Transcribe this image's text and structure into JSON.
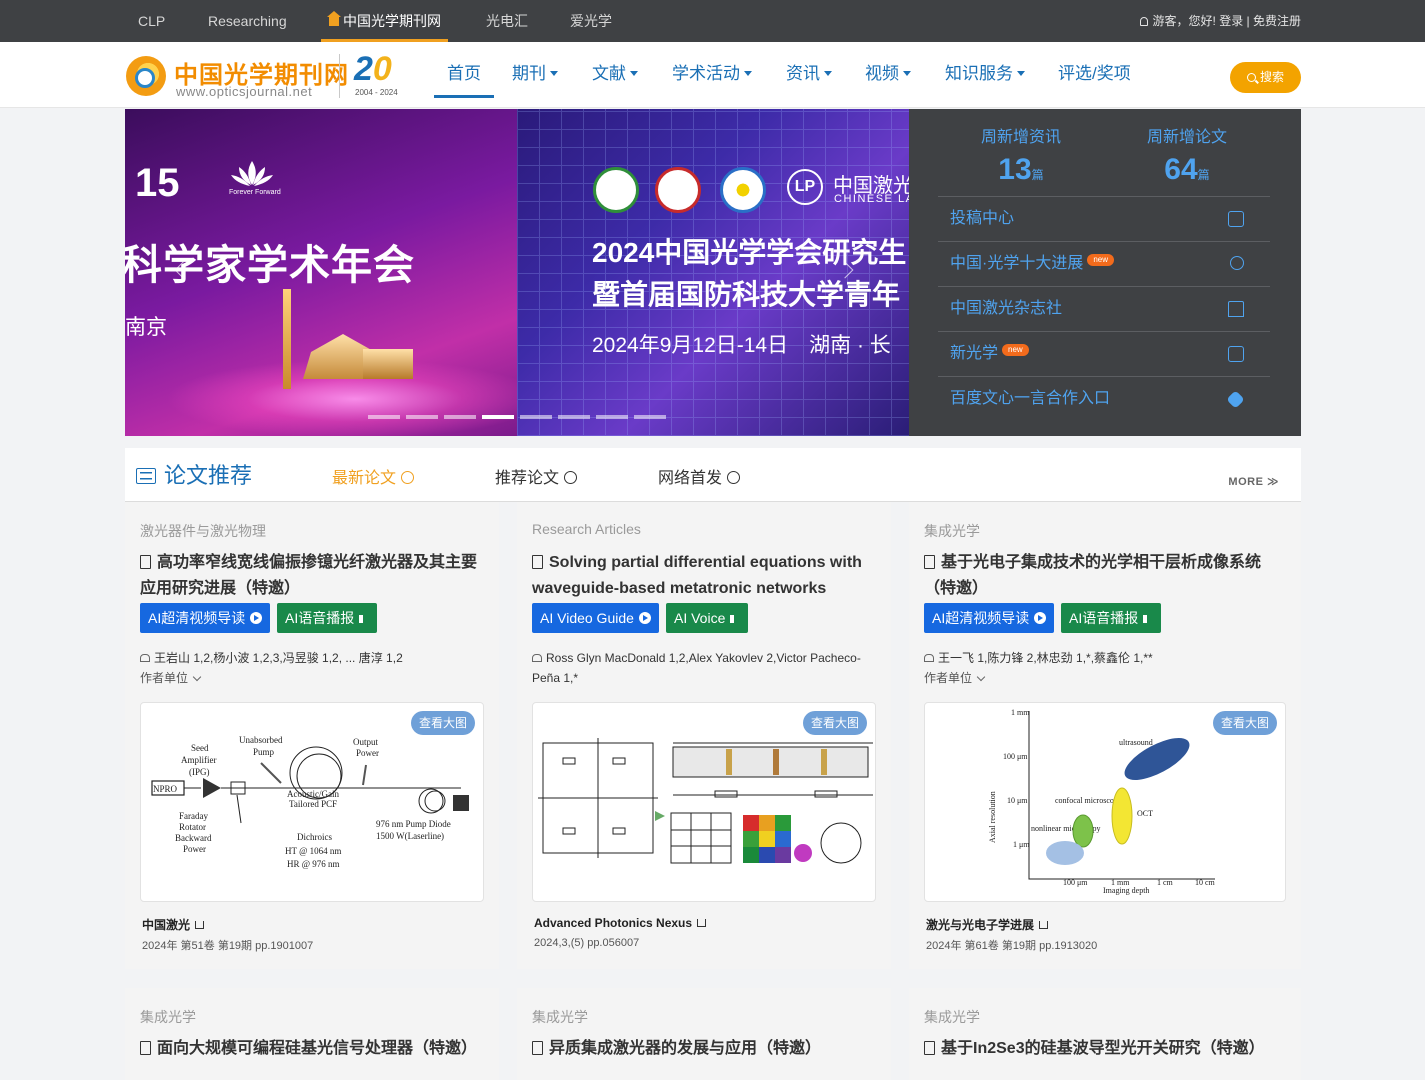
{
  "topbar": {
    "links": [
      "CLP",
      "Researching",
      "中国光学期刊网",
      "光电汇",
      "爱光学"
    ],
    "user_text": "游客，您好! 登录 | 免费注册"
  },
  "header": {
    "logo_cn": "中国光学期刊网",
    "logo_en": "www.opticsjournal.net",
    "logo_years": "2004 - 2024",
    "nav": [
      "首页",
      "期刊",
      "文献",
      "学术活动",
      "资讯",
      "视频",
      "知识服务",
      "评选/奖项"
    ],
    "search_label": "搜索"
  },
  "banner": {
    "slide1": {
      "logo_num": "15",
      "logo_sub": "Forever Forward",
      "title": "科学家学术年会",
      "place": "南京"
    },
    "slide2": {
      "lp_cn": "中国激光",
      "lp_en": "CHINESE LA",
      "line1": "2024中国光学学会研究生",
      "line2": "暨首届国防科技大学青年",
      "line3": "2024年9月12日-14日　湖南 · 长"
    }
  },
  "side": {
    "stat1_label": "周新增资讯",
    "stat1_value": "13",
    "stat1_unit": "篇",
    "stat2_label": "周新增论文",
    "stat2_value": "64",
    "stat2_unit": "篇",
    "links": [
      "投稿中心",
      "中国·光学十大进展",
      "中国激光杂志社",
      "新光学",
      "百度文心一言合作入口"
    ],
    "new_badge": "new"
  },
  "section": {
    "title": "论文推荐",
    "tabs": [
      "最新论文",
      "推荐论文",
      "网络首发"
    ],
    "more": "MORE"
  },
  "cards": [
    {
      "category": "激光器件与激光物理",
      "title": "高功率窄线宽线偏振掺镱光纤激光器及其主要应用研究进展（特邀）",
      "btn1": "AI超清视频导读",
      "btn2": "AI语音播报",
      "authors": "王岩山 1,2,杨小波 1,2,3,冯昱骏 1,2, ... 唐淳 1,2",
      "unit": "作者单位",
      "view": "查看大图",
      "journal": "中国激光",
      "volume": "2024年 第51卷 第19期 pp.1901007"
    },
    {
      "category": "Research Articles",
      "title": "Solving partial differential equations with waveguide-based metatronic networks",
      "btn1": "AI Video Guide",
      "btn2": "AI Voice",
      "authors": "Ross Glyn MacDonald 1,2,Alex Yakovlev 2,Victor Pacheco-Peña 1,*",
      "unit": "",
      "view": "查看大图",
      "journal": "Advanced Photonics Nexus",
      "volume": "2024,3,(5) pp.056007"
    },
    {
      "category": "集成光学",
      "title": "基于光电子集成技术的光学相干层析成像系统（特邀）",
      "btn1": "AI超清视频导读",
      "btn2": "AI语音播报",
      "authors": "王一飞 1,陈力锋 2,林忠劲 1,*,蔡鑫伦 1,**",
      "unit": "作者单位",
      "view": "查看大图",
      "journal": "激光与光电子学进展",
      "volume": "2024年 第61卷 第19期 pp.1913020"
    }
  ],
  "cards_row2": [
    {
      "category": "集成光学",
      "title": "面向大规模可编程硅基光信号处理器（特邀）"
    },
    {
      "category": "集成光学",
      "title": "异质集成激光器的发展与应用（特邀）"
    },
    {
      "category": "集成光学",
      "title": "基于In2Se3的硅基波导型光开关研究（特邀）"
    }
  ],
  "fig1": {
    "labels": [
      "Seed",
      "Amplifier",
      "(IPG)",
      "Unabsorbed",
      "Pump",
      "Output",
      "Power",
      "NPRO",
      "Acoustic/Gain",
      "Tailored PCF",
      "Faraday",
      "Rotator",
      "Backward",
      "Power",
      "Dichroics",
      "HT @ 1064 nm",
      "HR @ 976 nm",
      "976 nm Pump Diode",
      "1500 W(Laserline)"
    ]
  },
  "fig3": {
    "ylabel": "Axial resolution",
    "xlabel": "Imaging depth",
    "yticks": [
      "1 mm",
      "100 μm",
      "10 μm",
      "1 μm"
    ],
    "xticks": [
      "100 μm",
      "1 mm",
      "1 cm",
      "10 cm"
    ],
    "regions": [
      "ultrasound",
      "confocal microscopy",
      "OCT",
      "nonlinear microscopy"
    ]
  }
}
